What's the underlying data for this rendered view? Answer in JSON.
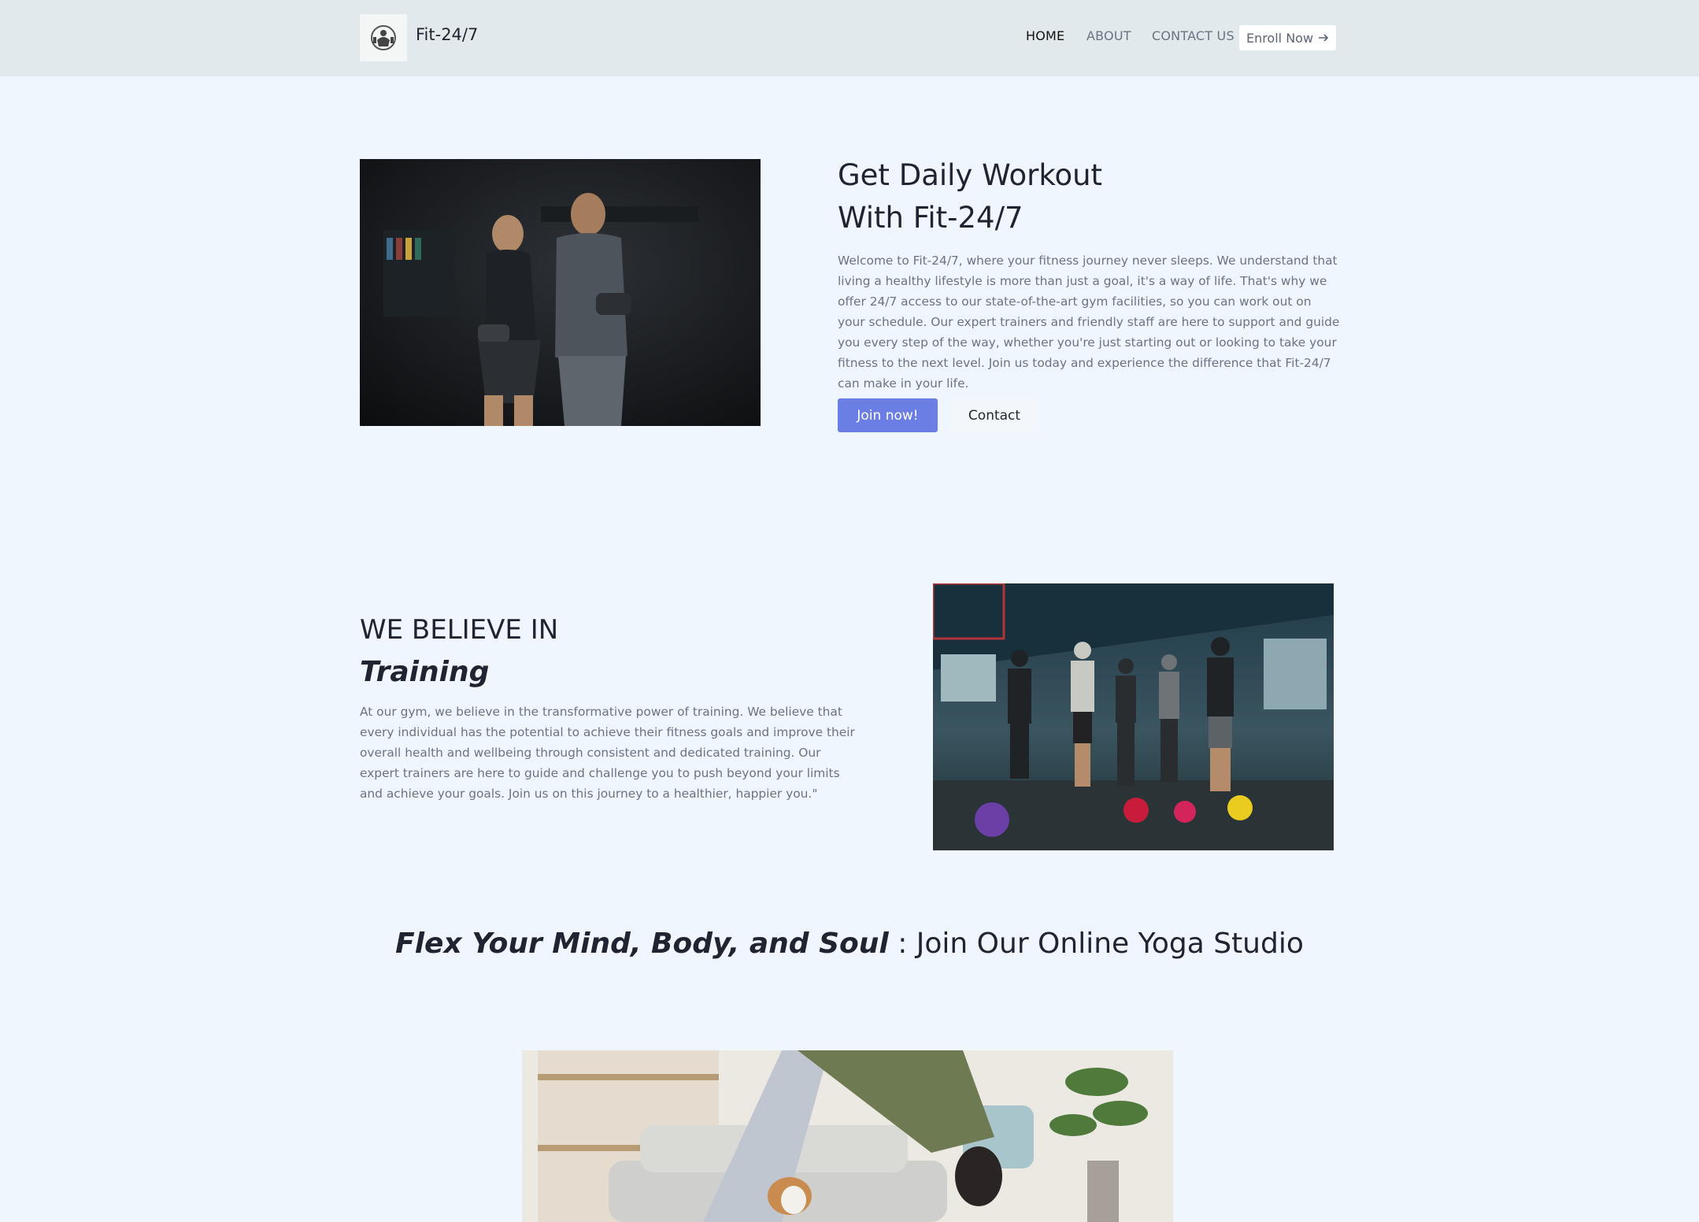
{
  "header": {
    "brand": "Fit-24/7",
    "nav": [
      "HOME",
      "ABOUT",
      "CONTACT US"
    ],
    "enroll_label": "Enroll Now",
    "enroll_icon": "arrow-right-icon",
    "logo_icon": "gym-logo-icon"
  },
  "hero": {
    "title_line1": "Get Daily Workout",
    "title_line2": "With Fit-24/7",
    "body": "Welcome to Fit-24/7, where your fitness journey never sleeps. We understand that living a healthy lifestyle is more than just a goal, it's a way of life. That's why we offer 24/7 access to our state-of-the-art gym facilities, so you can work out on your schedule. Our expert trainers and friendly staff are here to support and guide you every step of the way, whether you're just starting out or looking to take your fitness to the next level. Join us today and experience the difference that Fit-24/7 can make in your life.",
    "join_label": "Join now!",
    "contact_label": "Contact"
  },
  "believe": {
    "title_line1": "WE BELIEVE IN",
    "title_line2": "Training",
    "body": "At our gym, we believe in the transformative power of training. We believe that every individual has the potential to achieve their fitness goals and improve their overall health and wellbeing through consistent and dedicated training. Our expert trainers are here to guide and challenge you to push beyond your limits and achieve your goals. Join us on this journey to a healthier, happier you.\""
  },
  "yoga": {
    "title_emphasis": "Flex Your Mind, Body, and Soul",
    "title_rest": ": Join Our Online Yoga Studio"
  },
  "colors": {
    "page_bg": "#eff6fd",
    "header_bg": "#e2e9ec",
    "primary_button": "#6b7ee3",
    "muted_text": "#6b7382"
  }
}
